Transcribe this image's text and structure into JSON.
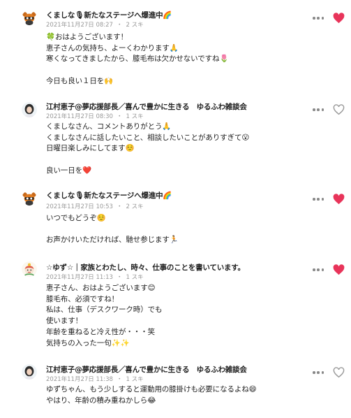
{
  "colors": {
    "liked": "#e8345a",
    "unliked": "#999999",
    "meta": "#999999"
  },
  "comments": [
    {
      "author": "くましな🎙新たなステージへ爆進中🌈",
      "date": "2021年11月27日 08:27",
      "likes": "2 スキ",
      "body": "🍀おはようございます！\n恵子さんの気持ち、よーくわかります🙏\n寒くなってきましたから、膝毛布は欠かせないですね🌷\n\n今日も良い１日を🙌",
      "liked": true,
      "avatar_icon": "bear-character-icon"
    },
    {
      "author": "江村恵子@夢応援部長／喜んで豊かに生きる　ゆるふわ雑談会",
      "date": "2021年11月27日 08:30",
      "likes": "1 スキ",
      "body": "くましなさん、コメントありがとう🙏\nくましなさんに話したいこと、相談したいことがありすぎて😮\n日曜日楽しみにしてます☺️\n\n良い一日を❤️",
      "liked": false,
      "avatar_icon": "woman-portrait-icon"
    },
    {
      "author": "くましな🎙新たなステージへ爆進中🌈",
      "date": "2021年11月27日 10:53",
      "likes": "2 スキ",
      "body": "いつでもどうぞ☺️\n\nお声かけいただければ、馳せ参じます🏃",
      "liked": true,
      "avatar_icon": "bear-character-icon"
    },
    {
      "author": "☆ゆず☆｜家族とわたし、時々、仕事のことを書いています。",
      "date": "2021年11月27日 11:13",
      "likes": "1 スキ",
      "body": "恵子さん、おはようございます😊\n膝毛布、必須ですね！\n私は、仕事（デスクワーク時）でも\n使います！\n年齢を重ねると冷え性が・・・笑\n気持ちの入った一句✨✨",
      "liked": true,
      "avatar_icon": "yuzu-character-icon"
    },
    {
      "author": "江村恵子@夢応援部長／喜んで豊かに生きる　ゆるふわ雑談会",
      "date": "2021年11月27日 11:38",
      "likes": "1 スキ",
      "body": "ゆずちゃん、もう少しすると運動用の膝掛けも必要になるよね😄\nやはり、年齢の積み重ねかしら😂",
      "liked": false,
      "avatar_icon": "woman-portrait-icon"
    }
  ]
}
